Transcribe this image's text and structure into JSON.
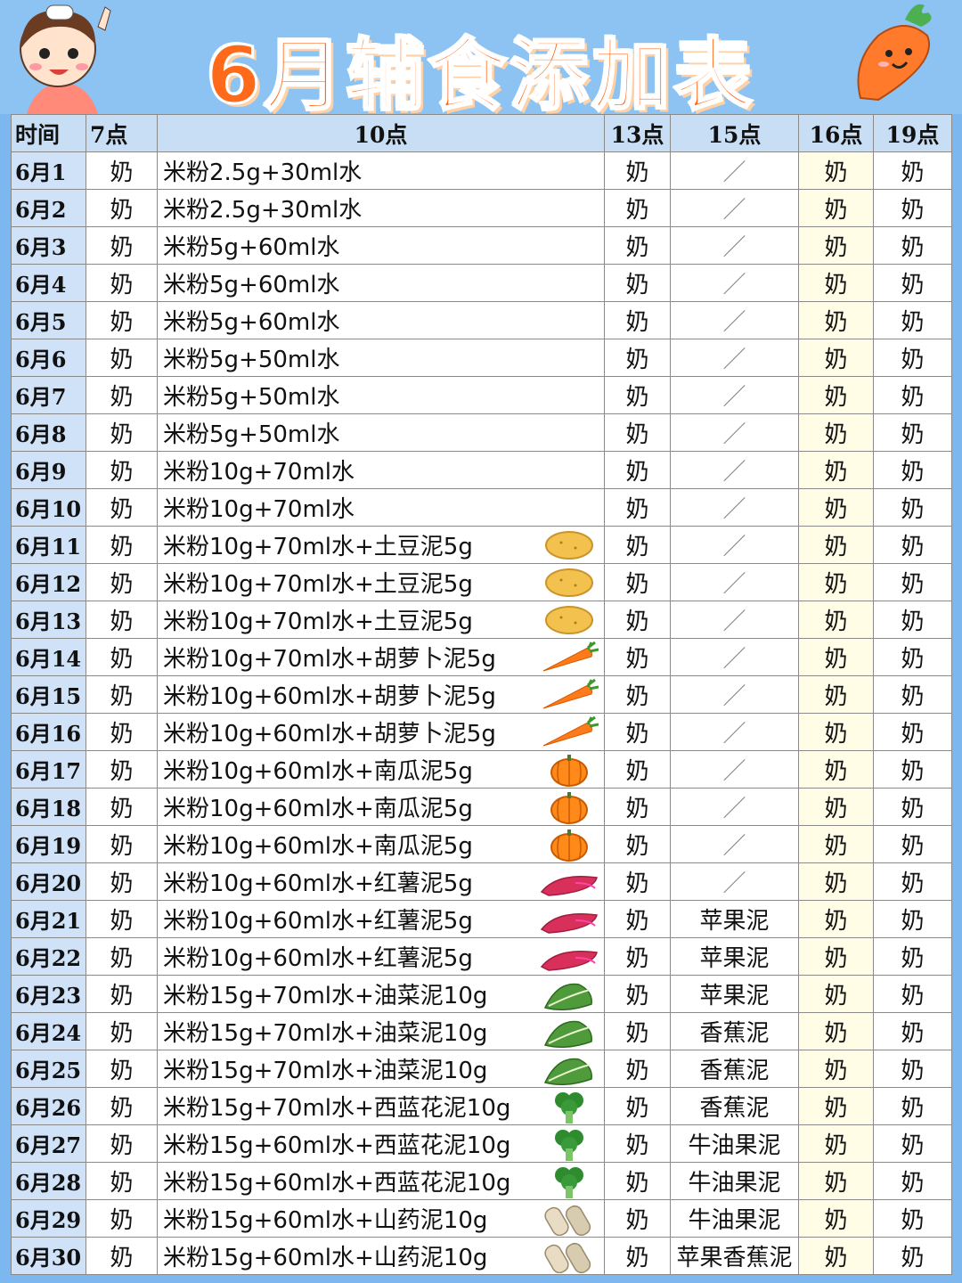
{
  "title": "6月辅食添加表",
  "columns": [
    "时间",
    "7点",
    "10点",
    "13点",
    "15点",
    "16点",
    "19点"
  ],
  "rows": [
    {
      "date": "6月1",
      "c7": "奶",
      "meal": "米粉2.5g+30ml水",
      "icon": "",
      "c13": "奶",
      "c15": "／",
      "c16": "奶",
      "c19": "奶"
    },
    {
      "date": "6月2",
      "c7": "奶",
      "meal": "米粉2.5g+30ml水",
      "icon": "",
      "c13": "奶",
      "c15": "／",
      "c16": "奶",
      "c19": "奶"
    },
    {
      "date": "6月3",
      "c7": "奶",
      "meal": "米粉5g+60ml水",
      "icon": "",
      "c13": "奶",
      "c15": "／",
      "c16": "奶",
      "c19": "奶"
    },
    {
      "date": "6月4",
      "c7": "奶",
      "meal": "米粉5g+60ml水",
      "icon": "",
      "c13": "奶",
      "c15": "／",
      "c16": "奶",
      "c19": "奶"
    },
    {
      "date": "6月5",
      "c7": "奶",
      "meal": "米粉5g+60ml水",
      "icon": "",
      "c13": "奶",
      "c15": "／",
      "c16": "奶",
      "c19": "奶"
    },
    {
      "date": "6月6",
      "c7": "奶",
      "meal": "米粉5g+50ml水",
      "icon": "",
      "c13": "奶",
      "c15": "／",
      "c16": "奶",
      "c19": "奶"
    },
    {
      "date": "6月7",
      "c7": "奶",
      "meal": "米粉5g+50ml水",
      "icon": "",
      "c13": "奶",
      "c15": "／",
      "c16": "奶",
      "c19": "奶"
    },
    {
      "date": "6月8",
      "c7": "奶",
      "meal": "米粉5g+50ml水",
      "icon": "",
      "c13": "奶",
      "c15": "／",
      "c16": "奶",
      "c19": "奶"
    },
    {
      "date": "6月9",
      "c7": "奶",
      "meal": "米粉10g+70ml水",
      "icon": "",
      "c13": "奶",
      "c15": "／",
      "c16": "奶",
      "c19": "奶"
    },
    {
      "date": "6月10",
      "c7": "奶",
      "meal": "米粉10g+70ml水",
      "icon": "",
      "c13": "奶",
      "c15": "／",
      "c16": "奶",
      "c19": "奶"
    },
    {
      "date": "6月11",
      "c7": "奶",
      "meal": "米粉10g+70ml水+土豆泥5g",
      "icon": "potato-icon",
      "c13": "奶",
      "c15": "／",
      "c16": "奶",
      "c19": "奶"
    },
    {
      "date": "6月12",
      "c7": "奶",
      "meal": "米粉10g+70ml水+土豆泥5g",
      "icon": "potato-icon",
      "c13": "奶",
      "c15": "／",
      "c16": "奶",
      "c19": "奶"
    },
    {
      "date": "6月13",
      "c7": "奶",
      "meal": "米粉10g+70ml水+土豆泥5g",
      "icon": "potato-icon",
      "c13": "奶",
      "c15": "／",
      "c16": "奶",
      "c19": "奶"
    },
    {
      "date": "6月14",
      "c7": "奶",
      "meal": "米粉10g+70ml水+胡萝卜泥5g",
      "icon": "carrot-icon",
      "c13": "奶",
      "c15": "／",
      "c16": "奶",
      "c19": "奶"
    },
    {
      "date": "6月15",
      "c7": "奶",
      "meal": "米粉10g+60ml水+胡萝卜泥5g",
      "icon": "carrot-icon",
      "c13": "奶",
      "c15": "／",
      "c16": "奶",
      "c19": "奶"
    },
    {
      "date": "6月16",
      "c7": "奶",
      "meal": "米粉10g+60ml水+胡萝卜泥5g",
      "icon": "carrot-icon",
      "c13": "奶",
      "c15": "／",
      "c16": "奶",
      "c19": "奶"
    },
    {
      "date": "6月17",
      "c7": "奶",
      "meal": "米粉10g+60ml水+南瓜泥5g",
      "icon": "pumpkin-icon",
      "c13": "奶",
      "c15": "／",
      "c16": "奶",
      "c19": "奶"
    },
    {
      "date": "6月18",
      "c7": "奶",
      "meal": "米粉10g+60ml水+南瓜泥5g",
      "icon": "pumpkin-icon",
      "c13": "奶",
      "c15": "／",
      "c16": "奶",
      "c19": "奶"
    },
    {
      "date": "6月19",
      "c7": "奶",
      "meal": "米粉10g+60ml水+南瓜泥5g",
      "icon": "pumpkin-icon",
      "c13": "奶",
      "c15": "／",
      "c16": "奶",
      "c19": "奶"
    },
    {
      "date": "6月20",
      "c7": "奶",
      "meal": "米粉10g+60ml水+红薯泥5g",
      "icon": "sweet-potato-icon",
      "c13": "奶",
      "c15": "／",
      "c16": "奶",
      "c19": "奶"
    },
    {
      "date": "6月21",
      "c7": "奶",
      "meal": "米粉10g+60ml水+红薯泥5g",
      "icon": "sweet-potato-icon",
      "c13": "奶",
      "c15": "苹果泥",
      "c16": "奶",
      "c19": "奶"
    },
    {
      "date": "6月22",
      "c7": "奶",
      "meal": "米粉10g+60ml水+红薯泥5g",
      "icon": "sweet-potato-icon",
      "c13": "奶",
      "c15": "苹果泥",
      "c16": "奶",
      "c19": "奶"
    },
    {
      "date": "6月23",
      "c7": "奶",
      "meal": "米粉15g+70ml水+油菜泥10g",
      "icon": "greens-icon",
      "c13": "奶",
      "c15": "苹果泥",
      "c16": "奶",
      "c19": "奶"
    },
    {
      "date": "6月24",
      "c7": "奶",
      "meal": "米粉15g+70ml水+油菜泥10g",
      "icon": "greens-icon",
      "c13": "奶",
      "c15": "香蕉泥",
      "c16": "奶",
      "c19": "奶"
    },
    {
      "date": "6月25",
      "c7": "奶",
      "meal": "米粉15g+70ml水+油菜泥10g",
      "icon": "greens-icon",
      "c13": "奶",
      "c15": "香蕉泥",
      "c16": "奶",
      "c19": "奶"
    },
    {
      "date": "6月26",
      "c7": "奶",
      "meal": "米粉15g+70ml水+西蓝花泥10g",
      "icon": "broccoli-icon",
      "c13": "奶",
      "c15": "香蕉泥",
      "c16": "奶",
      "c19": "奶"
    },
    {
      "date": "6月27",
      "c7": "奶",
      "meal": "米粉15g+60ml水+西蓝花泥10g",
      "icon": "broccoli-icon",
      "c13": "奶",
      "c15": "牛油果泥",
      "c16": "奶",
      "c19": "奶"
    },
    {
      "date": "6月28",
      "c7": "奶",
      "meal": "米粉15g+60ml水+西蓝花泥10g",
      "icon": "broccoli-icon",
      "c13": "奶",
      "c15": "牛油果泥",
      "c16": "奶",
      "c19": "奶"
    },
    {
      "date": "6月29",
      "c7": "奶",
      "meal": "米粉15g+60ml水+山药泥10g",
      "icon": "yam-icon",
      "c13": "奶",
      "c15": "牛油果泥",
      "c16": "奶",
      "c19": "奶"
    },
    {
      "date": "6月30",
      "c7": "奶",
      "meal": "米粉15g+60ml水+山药泥10g",
      "icon": "yam-icon",
      "c13": "奶",
      "c15": "苹果香蕉泥",
      "c16": "奶",
      "c19": "奶"
    }
  ]
}
